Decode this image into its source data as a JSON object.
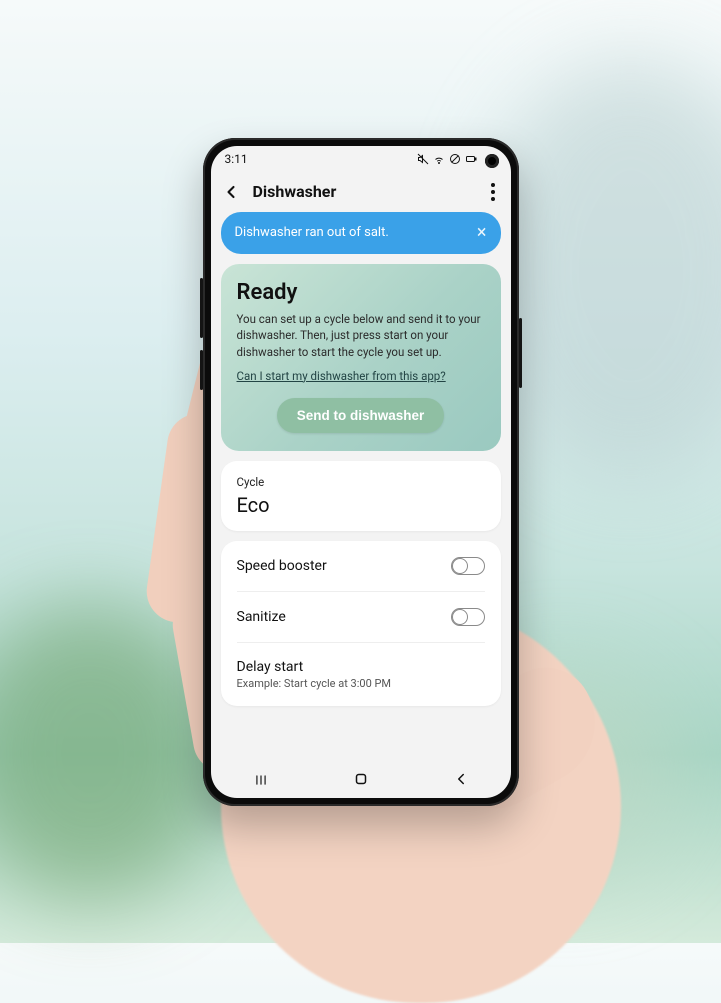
{
  "status": {
    "time": "3:11"
  },
  "header": {
    "title": "Dishwasher"
  },
  "banner": {
    "text": "Dishwasher ran out of salt."
  },
  "ready": {
    "title": "Ready",
    "body": "You can set up a cycle below and send it to your dishwasher. Then, just press start on your dishwasher to start the cycle you set up.",
    "link": "Can I start my dishwasher from this app?",
    "button": "Send to dishwasher"
  },
  "cycle": {
    "label": "Cycle",
    "value": "Eco"
  },
  "options": {
    "speed_booster": {
      "label": "Speed booster",
      "on": false
    },
    "sanitize": {
      "label": "Sanitize",
      "on": false
    },
    "delay": {
      "label": "Delay start",
      "sub": "Example: Start cycle at 3:00 PM"
    }
  }
}
